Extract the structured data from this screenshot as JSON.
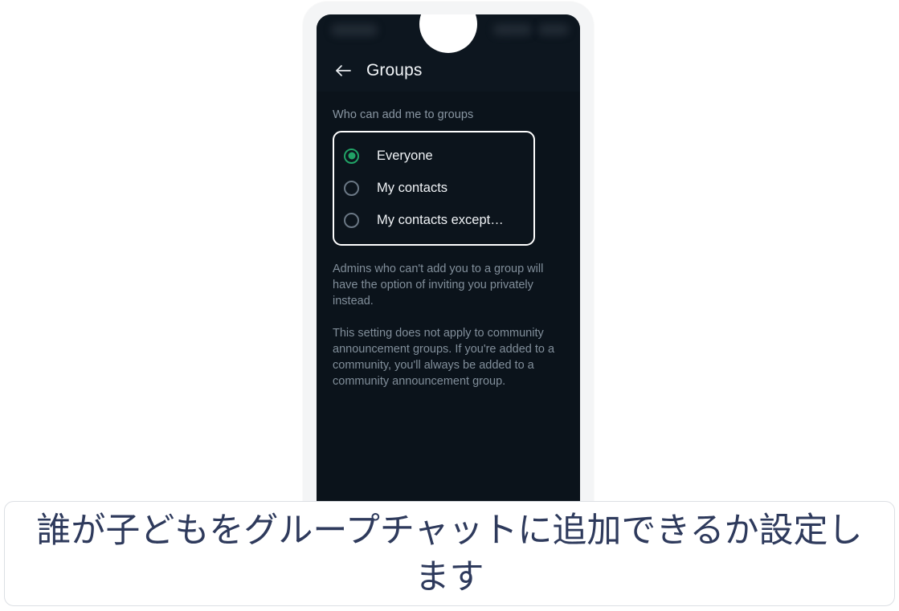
{
  "phone": {
    "status_bar": {
      "left_indicator": "",
      "right_indicator_1": "",
      "right_indicator_2": ""
    },
    "app_bar": {
      "back_icon": "back-arrow-icon",
      "title": "Groups"
    },
    "content": {
      "section_label": "Who can add me to groups",
      "options": [
        {
          "label": "Everyone",
          "selected": true
        },
        {
          "label": "My contacts",
          "selected": false
        },
        {
          "label": "My contacts except…",
          "selected": false
        }
      ],
      "descriptions": [
        "Admins who can't add you to a group will have the option of inviting you privately instead.",
        "This setting does not apply to community announcement groups. If you're added to a community, you'll always be added to a community announcement group."
      ]
    }
  },
  "caption": {
    "text": "誰が子どもをグループチャットに追加できるか設定します"
  },
  "colors": {
    "accent_green": "#21a366",
    "screen_background": "#0b131b",
    "app_bar_background": "#0d161f",
    "caption_text": "#2e3a5c",
    "highlight_border": "#ffffff"
  }
}
